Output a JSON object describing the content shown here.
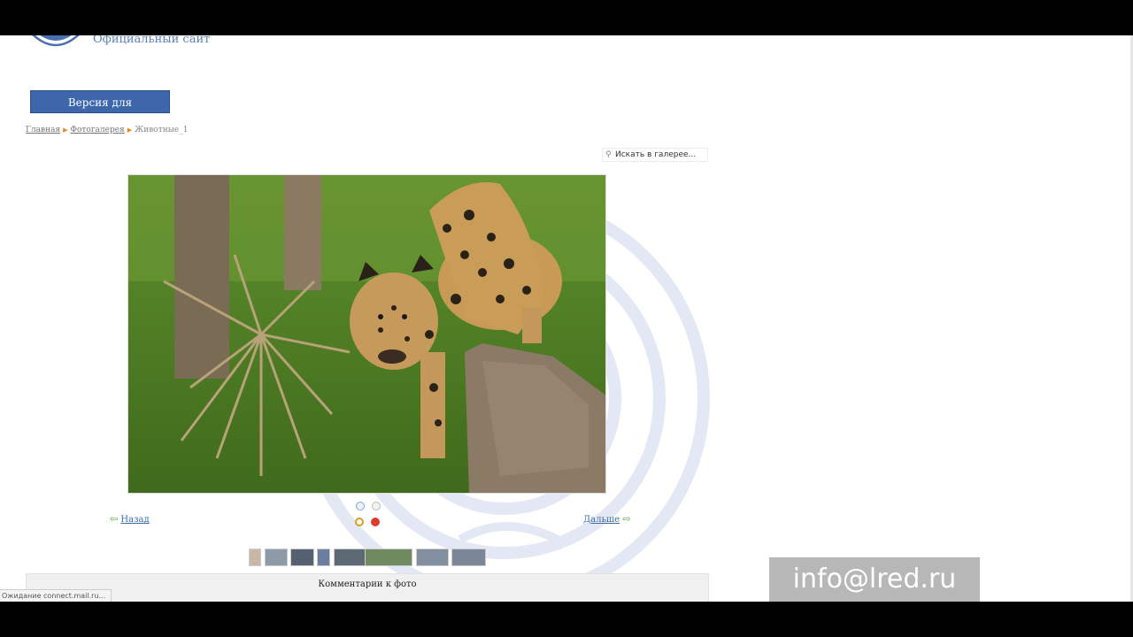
{
  "header": {
    "site_subtitle": "Официальный сайт",
    "low_vision_button": "Версия для слабовидящих"
  },
  "breadcrumb": {
    "items": [
      "Главная",
      "Фотогалерея",
      "Животные_1"
    ]
  },
  "gallery": {
    "search_placeholder": "Искать в галерее...",
    "photo_subject": "jaguar",
    "prev_label": "Назад",
    "next_label": "Дальше",
    "thumbnail_count": 8
  },
  "comments": {
    "title": "Комментарии к фото"
  },
  "statusbar": {
    "text": "Ожидание connect.mail.ru..."
  },
  "overlay": {
    "email": "info@lred.ru"
  },
  "colors": {
    "accent": "#3e66aa",
    "link": "#3a6ea5",
    "arrow": "#47a02e",
    "crumb_separator": "#e08a1e",
    "email_bg": "#b7b7b7"
  }
}
